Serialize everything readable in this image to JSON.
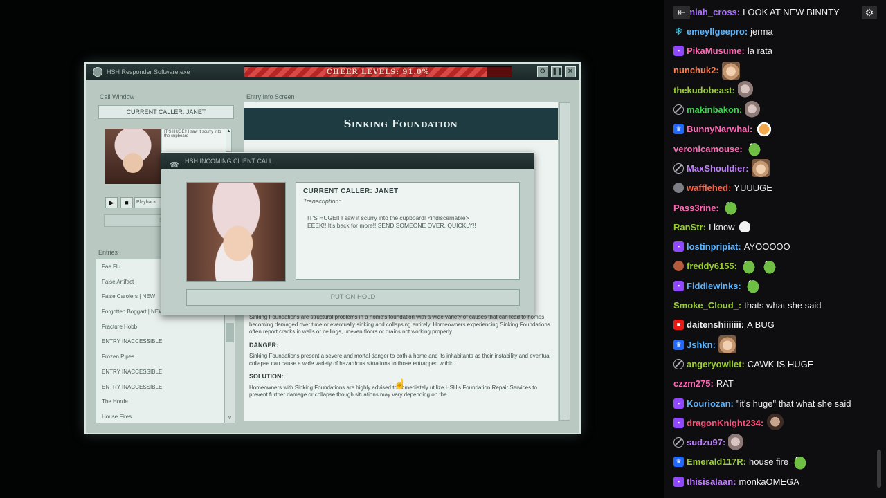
{
  "app": {
    "window_title": "HSH Responder Software.exe",
    "cheer_label": "CHEER LEVELS: 91.0%",
    "cheer_level": 0.91
  },
  "call_window": {
    "label": "Call Window",
    "current_caller": "CURRENT CALLER: JANET",
    "transcript_snippet": "IT'S HUGE!! I saw it scurry into the cupboard",
    "playback_label": "Playback",
    "submit_label": "SUBMIT"
  },
  "entries": {
    "label": "Entries",
    "items": [
      "Fae Flu",
      "False Artifact",
      "False Carolers | NEW",
      "Forgotten Boggart | NEW",
      "Fracture Hobb",
      "ENTRY INACCESSIBLE",
      "Frozen Pipes",
      "ENTRY INACCESSIBLE",
      "ENTRY INACCESSIBLE",
      "The Horde",
      "House Fires"
    ]
  },
  "entry_info": {
    "label": "Entry Info Screen",
    "title": "Sinking Foundation",
    "description": "Sinking Foundations are structural problems in a home's foundation with a wide variety of causes that can lead to homes becoming damaged over time or eventually sinking and collapsing entirely. Homeowners experiencing Sinking Foundations often report cracks in walls or ceilings, uneven floors or drains not working properly.",
    "danger_heading": "DANGER:",
    "danger_text": "Sinking Foundations present a severe and mortal danger to both a home and its inhabitants as their instability and eventual collapse can cause a wide variety of hazardous situations to those entrapped within.",
    "solution_heading": "SOLUTION:",
    "solution_text": "Homeowners with Sinking Foundations are highly advised to immediately utilize HSH's Foundation Repair Services to prevent further damage or collapse though situations may vary depending on the"
  },
  "dialog": {
    "title": "HSH INCOMING CLIENT CALL",
    "caller": "CURRENT CALLER: JANET",
    "transcription_label": "Transcription:",
    "transcript": "IT'S HUGE!! I saw it scurry into the cupboard! <indiscernable> EEEK!! It's back for more!! SEND SOMEONE OVER, QUICKLY!!",
    "hold_label": "PUT ON HOLD"
  },
  "chat": {
    "messages": [
      {
        "user": "eremiah_cross",
        "color": "#a970ff",
        "badge": "none",
        "text": "LOOK AT NEW BINNTY",
        "emote": ""
      },
      {
        "user": "emeyllgeepro",
        "color": "#5ab4ff",
        "badge": "snow",
        "text": "jerma",
        "emote": ""
      },
      {
        "user": "PikaMusume",
        "color": "#ff69b4",
        "badge": "sub",
        "text": "la rata",
        "emote": ""
      },
      {
        "user": "nunchuk2",
        "color": "#ff7f50",
        "badge": "none",
        "text": "",
        "emote": "cat"
      },
      {
        "user": "thekudobeast",
        "color": "#9acd32",
        "badge": "none",
        "text": "",
        "emote": "mouse"
      },
      {
        "user": "makinbakon",
        "color": "#3cd34c",
        "badge": "muted",
        "text": "",
        "emote": "mouse"
      },
      {
        "user": "BunnyNarwhal",
        "color": "#ff69b4",
        "badge": "prime",
        "text": "",
        "emote": "tiger"
      },
      {
        "user": "veronicamouse",
        "color": "#ff69b4",
        "badge": "none",
        "text": "",
        "emote": "pepe"
      },
      {
        "user": "MaxShouldier",
        "color": "#bf7fff",
        "badge": "muted",
        "text": "",
        "emote": "cat"
      },
      {
        "user": "wafflehed",
        "color": "#ff6347",
        "badge": "gray",
        "text": "YUUUGE",
        "emote": ""
      },
      {
        "user": "Pass3rine",
        "color": "#ff69b4",
        "badge": "none",
        "text": "",
        "emote": "pepe"
      },
      {
        "user": "RanStr",
        "color": "#9acd32",
        "badge": "none",
        "text": "I know",
        "emote": "skull"
      },
      {
        "user": "lostinpripiat",
        "color": "#5ab4ff",
        "badge": "sub",
        "text": "AYOOOOO",
        "emote": ""
      },
      {
        "user": "freddy6155",
        "color": "#9acd32",
        "badge": "brown",
        "text": "",
        "emote": "pepe2"
      },
      {
        "user": "Fiddlewinks",
        "color": "#5ab4ff",
        "badge": "sub",
        "text": "",
        "emote": "pepe"
      },
      {
        "user": "Smoke_Cloud_",
        "color": "#9acd32",
        "badge": "none",
        "text": "thats what she said",
        "emote": ""
      },
      {
        "user": "daitenshiiiiiii",
        "color": "#efeff1",
        "badge": "red",
        "text": "A BUG",
        "emote": ""
      },
      {
        "user": "Jshkn",
        "color": "#5ab4ff",
        "badge": "prime",
        "text": "",
        "emote": "cat"
      },
      {
        "user": "angeryowllet",
        "color": "#9acd32",
        "badge": "muted",
        "text": "CAWK IS HUGE",
        "emote": ""
      },
      {
        "user": "czzm275",
        "color": "#ff69b4",
        "badge": "none",
        "text": "RAT",
        "emote": ""
      },
      {
        "user": "Kouriozan",
        "color": "#5ab4ff",
        "badge": "sub",
        "text": "\"it's huge\" that what she said",
        "emote": ""
      },
      {
        "user": "dragonKnight234",
        "color": "#ff4f7b",
        "badge": "sub",
        "text": "",
        "emote": "face"
      },
      {
        "user": "sudzu97",
        "color": "#bf7fff",
        "badge": "muted",
        "text": "",
        "emote": "mouse"
      },
      {
        "user": "Emerald117R",
        "color": "#9acd32",
        "badge": "prime",
        "text": "house fire",
        "emote": "pepe"
      },
      {
        "user": "thisisalaan",
        "color": "#bf7fff",
        "badge": "sub",
        "text": "monkaOMEGA",
        "emote": ""
      }
    ]
  }
}
